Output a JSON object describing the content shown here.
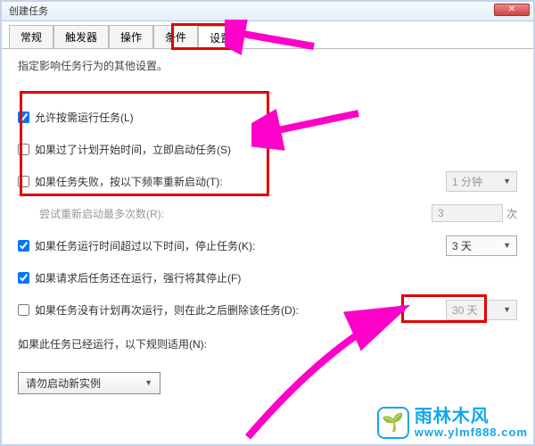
{
  "window": {
    "title": "创建任务"
  },
  "tabs": {
    "items": [
      {
        "label": "常规"
      },
      {
        "label": "触发器"
      },
      {
        "label": "操作"
      },
      {
        "label": "条件"
      },
      {
        "label": "设置"
      }
    ],
    "active_index": 4
  },
  "subtitle": "指定影响任务行为的其他设置。",
  "options": {
    "allow_on_demand": {
      "label": "允许按需运行任务(L)",
      "checked": true
    },
    "run_if_missed": {
      "label": "如果过了计划开始时间，立即启动任务(S)",
      "checked": false
    },
    "restart_on_fail": {
      "label": "如果任务失败，按以下频率重新启动(T):",
      "checked": false,
      "interval": "1 分钟"
    },
    "restart_attempts": {
      "label": "尝试重新启动最多次数(R):",
      "value": "3",
      "suffix": "次"
    },
    "stop_if_longer": {
      "label": "如果任务运行时间超过以下时间，停止任务(K):",
      "checked": true,
      "value": "3 天"
    },
    "force_stop_if_running": {
      "label": "如果请求后任务还在运行，强行将其停止(F)",
      "checked": true
    },
    "delete_if_not_scheduled": {
      "label": "如果任务没有计划再次运行，则在此之后删除该任务(D):",
      "checked": false,
      "value": "30 天"
    },
    "if_already_running": {
      "label": "如果此任务已经运行，以下规则适用(N):",
      "value": "请勿启动新实例"
    }
  },
  "branding": {
    "name": "雨林木风",
    "url": "www.ylmf888.com"
  },
  "icons": {
    "close": "✕",
    "sprout": "🌱"
  }
}
